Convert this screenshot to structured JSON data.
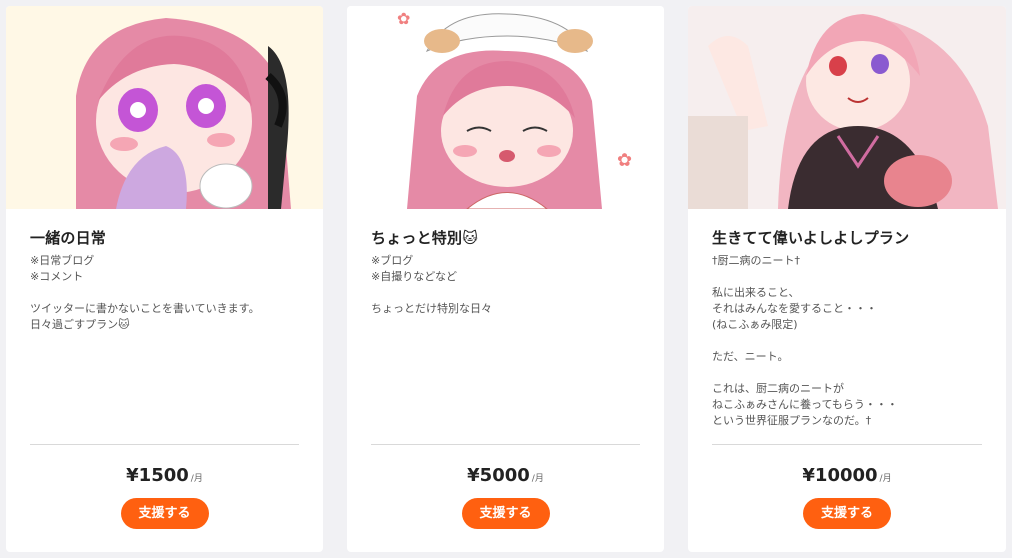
{
  "plans": [
    {
      "title": "一緒の日常",
      "lines": [
        "※日常ブログ",
        "※コメント",
        "",
        "ツイッターに書かないことを書いていきます。",
        "日々過ごすプラン🐱"
      ],
      "price": "¥1500",
      "unit": "/月",
      "button": "支援する"
    },
    {
      "title": "ちょっと特別🐱",
      "lines": [
        "※ブログ",
        "※自撮りなどなど",
        "",
        "ちょっとだけ特別な日々"
      ],
      "price": "¥5000",
      "unit": "/月",
      "button": "支援する"
    },
    {
      "title": "生きてて偉いよしよしプラン",
      "lines": [
        "†厨二病のニート†",
        "",
        "私に出来ること、",
        "それはみんなを愛すること・・・",
        "(ねこふぁみ限定)",
        "",
        "ただ、ニート。",
        "",
        "これは、厨二病のニートが",
        "ねこふぁみさんに養ってもらう・・・",
        "という世界征服プランなのだ。†"
      ],
      "price": "¥10000",
      "unit": "/月",
      "button": "支援する"
    }
  ],
  "colors": {
    "accent": "#ff6010",
    "background": "#f1f1f4",
    "card": "#ffffff"
  }
}
